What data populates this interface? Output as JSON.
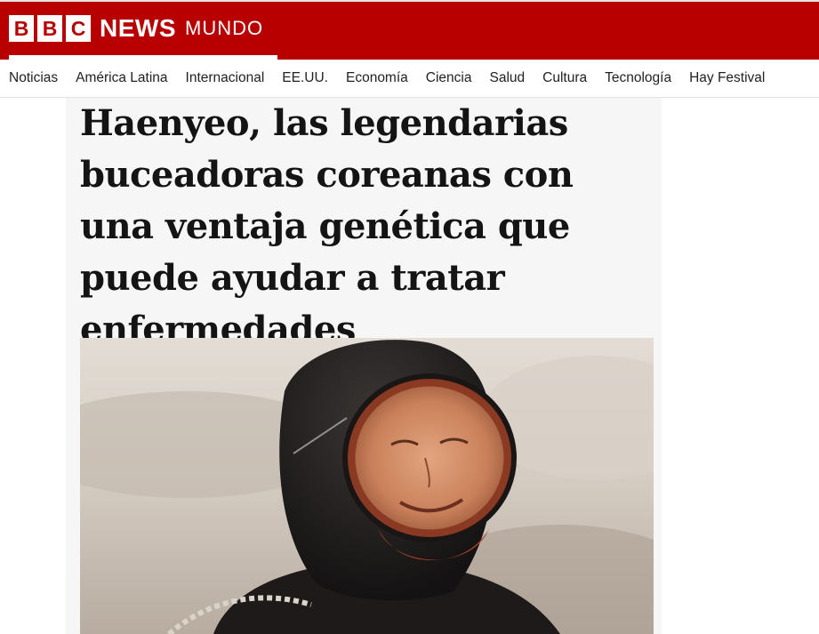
{
  "brand": {
    "bbc_letters": [
      "B",
      "B",
      "C"
    ],
    "news": "NEWS",
    "edition": "MUNDO",
    "color": "#b80000"
  },
  "nav": {
    "items": [
      "Noticias",
      "América Latina",
      "Internacional",
      "EE.UU.",
      "Economía",
      "Ciencia",
      "Salud",
      "Cultura",
      "Tecnología",
      "Hay Festival"
    ]
  },
  "article": {
    "headline": "Haenyeo, las legendarias buceadoras coreanas con una ventaja genética que puede ayudar a tratar enfermedades",
    "image": {
      "subject": "haenyeo-diver-photo"
    }
  }
}
